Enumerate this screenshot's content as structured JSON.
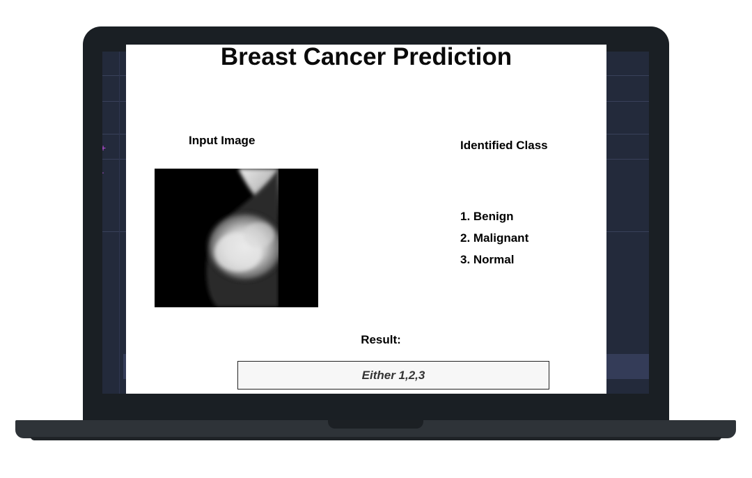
{
  "app": {
    "title": "Breast Cancer Prediction",
    "input_label": "Input Image",
    "class_label": "Identified Class",
    "classes": [
      "1. Benign",
      "2. Malignant",
      "3. Normal"
    ],
    "result_label": "Result:",
    "result_value": "Either 1,2,3"
  },
  "image": {
    "name": "mammogram-image"
  }
}
